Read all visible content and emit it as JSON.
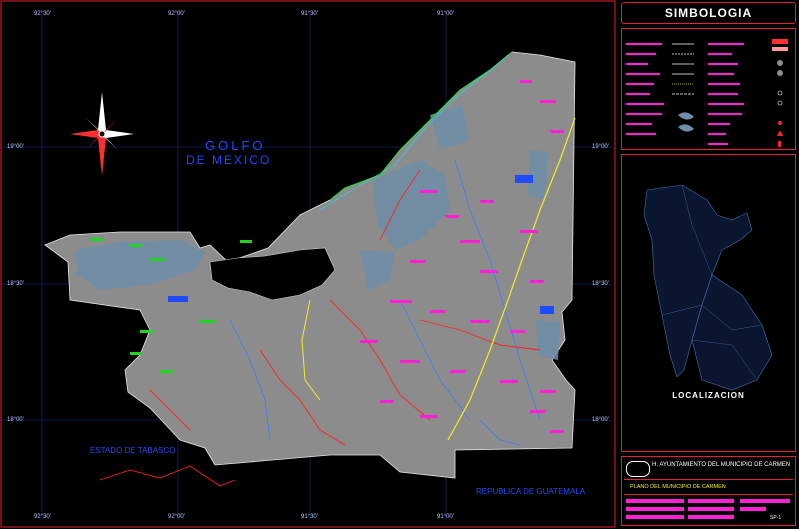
{
  "labels": {
    "gulf": [
      "GOLFO",
      "DE MEXICO"
    ],
    "tabasco": "ESTADO DE TABASCO",
    "guatemala": "REPUBLICA DE GUATEMALA"
  },
  "coords": {
    "top": [
      "92°30'",
      "92°00'",
      "91°30'",
      "91°00'"
    ],
    "left": [
      "19°00'",
      "18°30'",
      "18°00'"
    ],
    "right": [
      "19°00'",
      "18°30'",
      "18°00'"
    ],
    "bottom": [
      "92°30'",
      "92°00'",
      "91°30'",
      "91°00'"
    ]
  },
  "sidebar": {
    "title": "SIMBOLOGIA",
    "location_title": "LOCALIZACION",
    "institution": "H. AYUNTAMIENTO DEL MUNICIPIO DE CARMEN",
    "plan_title": "PLANO   DEL  MUNICIPIO DE CARMEN",
    "sheet": "SP-1"
  },
  "colors": {
    "land": "#8c8c8c",
    "roads": "#ff2020",
    "localities": "#ff1fd6",
    "hydro": "#3a7bff",
    "vegetation": "#22d422",
    "frame": "#e8202a"
  }
}
